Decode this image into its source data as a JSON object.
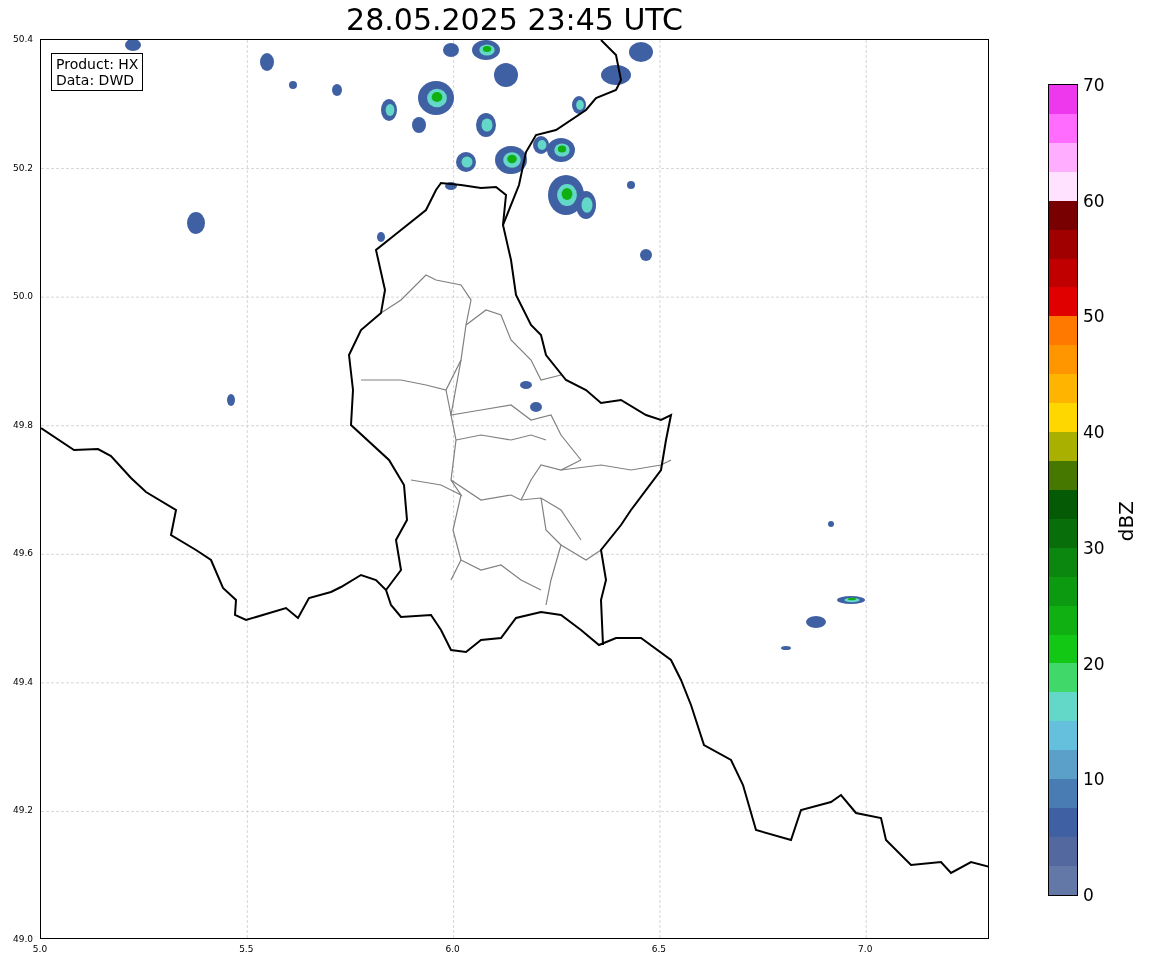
{
  "title": "28.05.2025 23:45 UTC",
  "info_box": {
    "lines": [
      "Product: HX",
      "Data: DWD"
    ]
  },
  "map": {
    "xticks": [
      "5.0",
      "5.5",
      "6.0",
      "6.5",
      "7.0"
    ],
    "yticks": [
      "50.4",
      "50.2",
      "50.0",
      "49.8",
      "49.6",
      "49.4",
      "49.2",
      "49.0"
    ]
  },
  "colorbar": {
    "label": "dBZ",
    "ticks": [
      "70",
      "60",
      "50",
      "40",
      "30",
      "20",
      "10",
      "0"
    ],
    "segments": [
      {
        "color": "#ee38ee"
      },
      {
        "color": "#ff6cff"
      },
      {
        "color": "#ffaeff"
      },
      {
        "color": "#ffe2ff"
      },
      {
        "color": "#780000"
      },
      {
        "color": "#a00000"
      },
      {
        "color": "#c00000"
      },
      {
        "color": "#e00000"
      },
      {
        "color": "#ff7800"
      },
      {
        "color": "#ff9600"
      },
      {
        "color": "#ffb400"
      },
      {
        "color": "#ffd700"
      },
      {
        "color": "#aab000"
      },
      {
        "color": "#467800"
      },
      {
        "color": "#055a05"
      },
      {
        "color": "#086e0a"
      },
      {
        "color": "#0b860e"
      },
      {
        "color": "#0c9a10"
      },
      {
        "color": "#10b012"
      },
      {
        "color": "#12c814"
      },
      {
        "color": "#40d868"
      },
      {
        "color": "#64d8c8"
      },
      {
        "color": "#64c0dc"
      },
      {
        "color": "#5aa0c8"
      },
      {
        "color": "#4a7cb4"
      },
      {
        "color": "#4060a4"
      },
      {
        "color": "#5468a0"
      },
      {
        "color": "#6478a8"
      }
    ]
  }
}
